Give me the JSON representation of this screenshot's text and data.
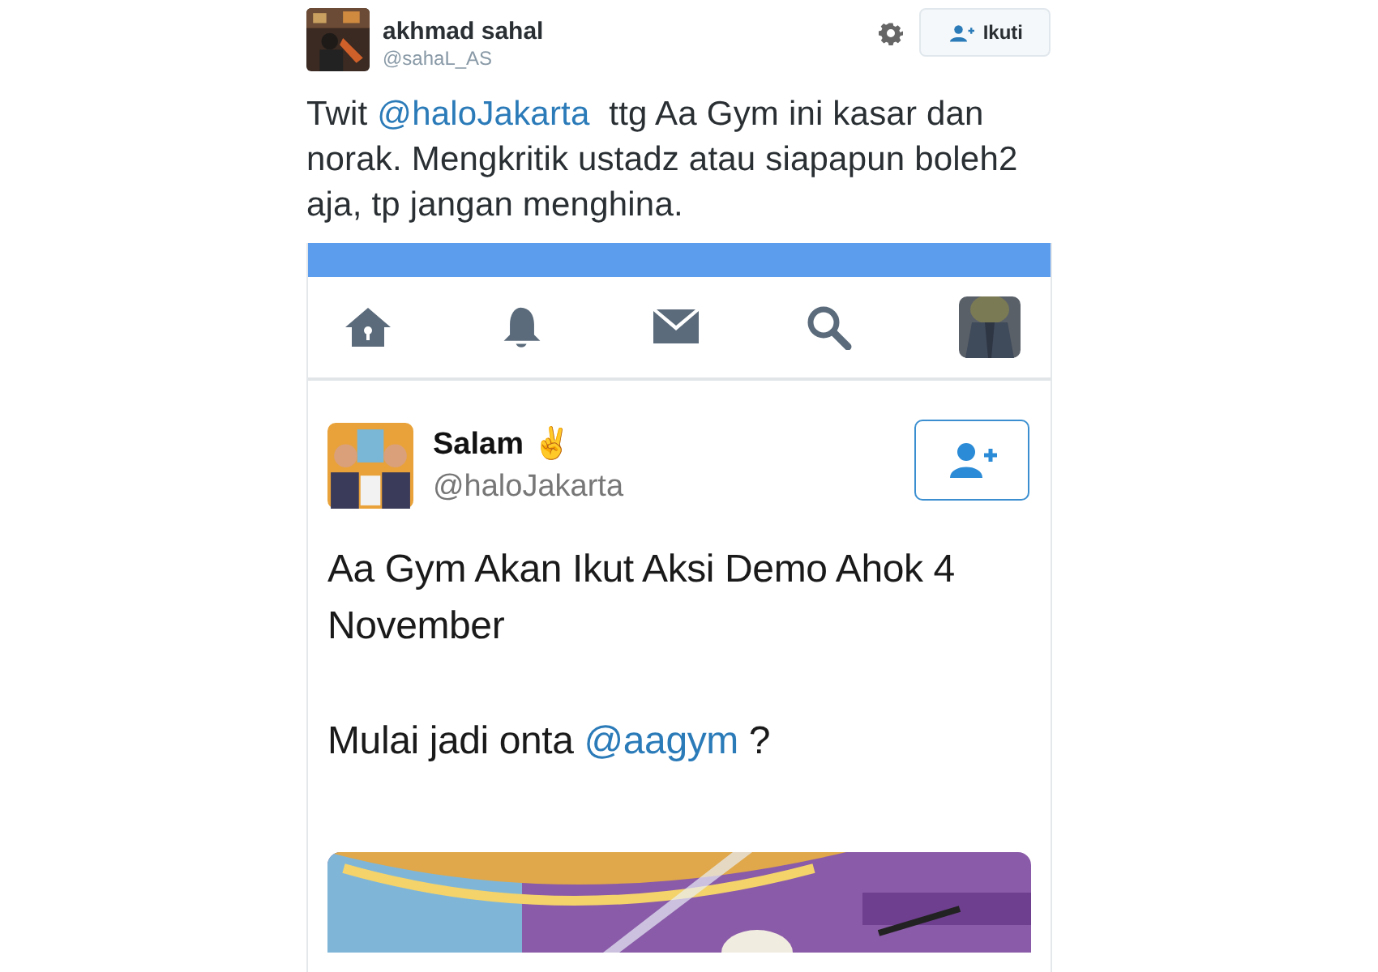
{
  "tweet": {
    "author": {
      "name": "akhmad sahal",
      "handle": "@sahaL_AS"
    },
    "follow_button": {
      "label": "Ikuti"
    },
    "text": [
      {
        "kind": "text",
        "text": "Twit "
      },
      {
        "kind": "mention",
        "text": "@haloJakarta"
      },
      {
        "kind": "text",
        "text": "  ttg Aa Gym ini kasar dan norak. Mengkritik ustadz atau siapapun boleh2 aja, tp jangan menghina."
      }
    ]
  },
  "embedded_screenshot": {
    "nav_items": [
      {
        "kind": "home"
      },
      {
        "kind": "bell"
      },
      {
        "kind": "mail"
      },
      {
        "kind": "search"
      },
      {
        "kind": "avatar"
      }
    ],
    "tweet": {
      "author": {
        "name": "Salam ✌",
        "handle": "@haloJakarta"
      },
      "paragraphs": [
        [
          {
            "kind": "text",
            "text": "Aa Gym Akan Ikut Aksi Demo Ahok 4 November"
          }
        ],
        [
          {
            "kind": "text",
            "text": "Mulai jadi onta "
          },
          {
            "kind": "mention",
            "text": "@aagym"
          },
          {
            "kind": "text",
            "text": " ?"
          }
        ]
      ],
      "media": {
        "kind": "picture"
      }
    }
  }
}
